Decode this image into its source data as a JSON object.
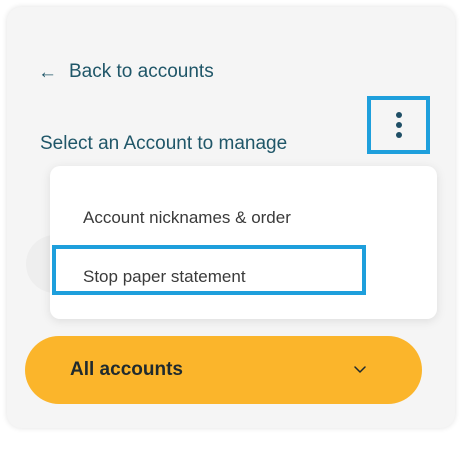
{
  "nav": {
    "back_arrow": "←",
    "back_label": "Back to accounts"
  },
  "header": {
    "select_label": "Select an Account to manage"
  },
  "more_options": {
    "icon": "vertical-ellipsis"
  },
  "menu": {
    "items": [
      {
        "label": "Account nicknames & order"
      },
      {
        "label": "Stop paper statement",
        "highlighted": true
      }
    ]
  },
  "account_select": {
    "selected": "All accounts",
    "icon": "chevron-down"
  },
  "colors": {
    "accent_link": "#1f5668",
    "highlight_outline": "#1e9fdc",
    "select_fill": "#fbb52b"
  }
}
